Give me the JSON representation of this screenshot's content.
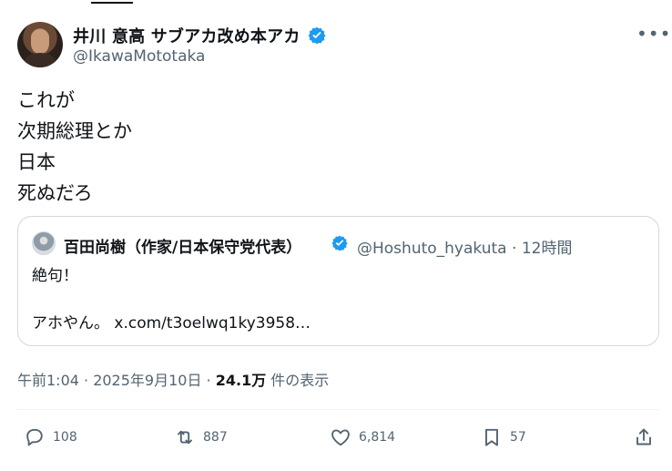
{
  "author": {
    "display_name": "井川 意高 サブアカ改め本アカ",
    "handle": "@IkawaMototaka"
  },
  "tweet": {
    "text": "これが\n次期総理とか\n日本\n死ぬだろ"
  },
  "quote": {
    "display_name": "百田尚樹（作家/日本保守党代表）",
    "handle": "@Hoshuto_hyakuta",
    "separator": "·",
    "time": "12時間",
    "text": "絶句！\n\nアホやん。 x.com/t3oelwq1ky3958…"
  },
  "meta": {
    "datetime": "午前1:04 · 2025年9月10日 · ",
    "views_count": "24.1万",
    "views_label": " 件の表示"
  },
  "actions": {
    "replies": "108",
    "retweets": "887",
    "likes": "6,814",
    "bookmarks": "57"
  },
  "icons": {
    "verified": "verified-badge-icon",
    "more": "more-icon",
    "reply": "reply-icon",
    "retweet": "retweet-icon",
    "like": "heart-icon",
    "bookmark": "bookmark-icon",
    "share": "share-icon"
  },
  "colors": {
    "text_primary": "#0f1419",
    "text_secondary": "#536471",
    "verified_blue": "#1d9bf0",
    "border": "#cfd9de"
  }
}
